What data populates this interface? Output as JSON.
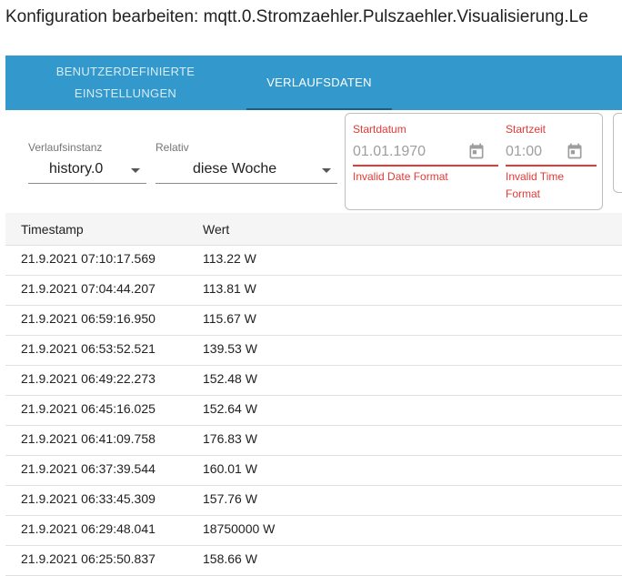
{
  "dialog": {
    "title": "Konfiguration bearbeiten: mqtt.0.Stromzaehler.Pulszaehler.Visualisierung.Le"
  },
  "tabs": [
    {
      "label_line1": "BENUTZERDEFINIERTE",
      "label_line2": "EINSTELLUNGEN",
      "active": false
    },
    {
      "label_line1": "VERLAUFSDATEN",
      "label_line2": "",
      "active": true
    }
  ],
  "filters": {
    "instance": {
      "label": "Verlaufsinstanz",
      "value": "history.0"
    },
    "relative": {
      "label": "Relativ",
      "value": "diese Woche"
    },
    "start_date": {
      "label": "Startdatum",
      "value": "01.01.1970",
      "error": "Invalid Date Format"
    },
    "start_time": {
      "label": "Startzeit",
      "value": "01:00",
      "error_line1": "Invalid Time",
      "error_line2": "Format"
    }
  },
  "table": {
    "headers": [
      "Timestamp",
      "Wert"
    ],
    "rows": [
      {
        "ts": "21.9.2021 07:10:17.569",
        "value": "113.22 W"
      },
      {
        "ts": "21.9.2021 07:04:44.207",
        "value": "113.81 W"
      },
      {
        "ts": "21.9.2021 06:59:16.950",
        "value": "115.67 W"
      },
      {
        "ts": "21.9.2021 06:53:52.521",
        "value": "139.53 W"
      },
      {
        "ts": "21.9.2021 06:49:22.273",
        "value": "152.48 W"
      },
      {
        "ts": "21.9.2021 06:45:16.025",
        "value": "152.64 W"
      },
      {
        "ts": "21.9.2021 06:41:09.758",
        "value": "176.83 W"
      },
      {
        "ts": "21.9.2021 06:37:39.544",
        "value": "160.01 W"
      },
      {
        "ts": "21.9.2021 06:33:45.309",
        "value": "157.76 W"
      },
      {
        "ts": "21.9.2021 06:29:48.041",
        "value": "18750000 W"
      },
      {
        "ts": "21.9.2021 06:25:50.837",
        "value": "158.66 W"
      }
    ]
  },
  "icons": {
    "calendar": "calendar-icon",
    "dropdown": "chevron-down-icon"
  },
  "colors": {
    "tabbar": "#3399cc",
    "error": "#e53935"
  }
}
